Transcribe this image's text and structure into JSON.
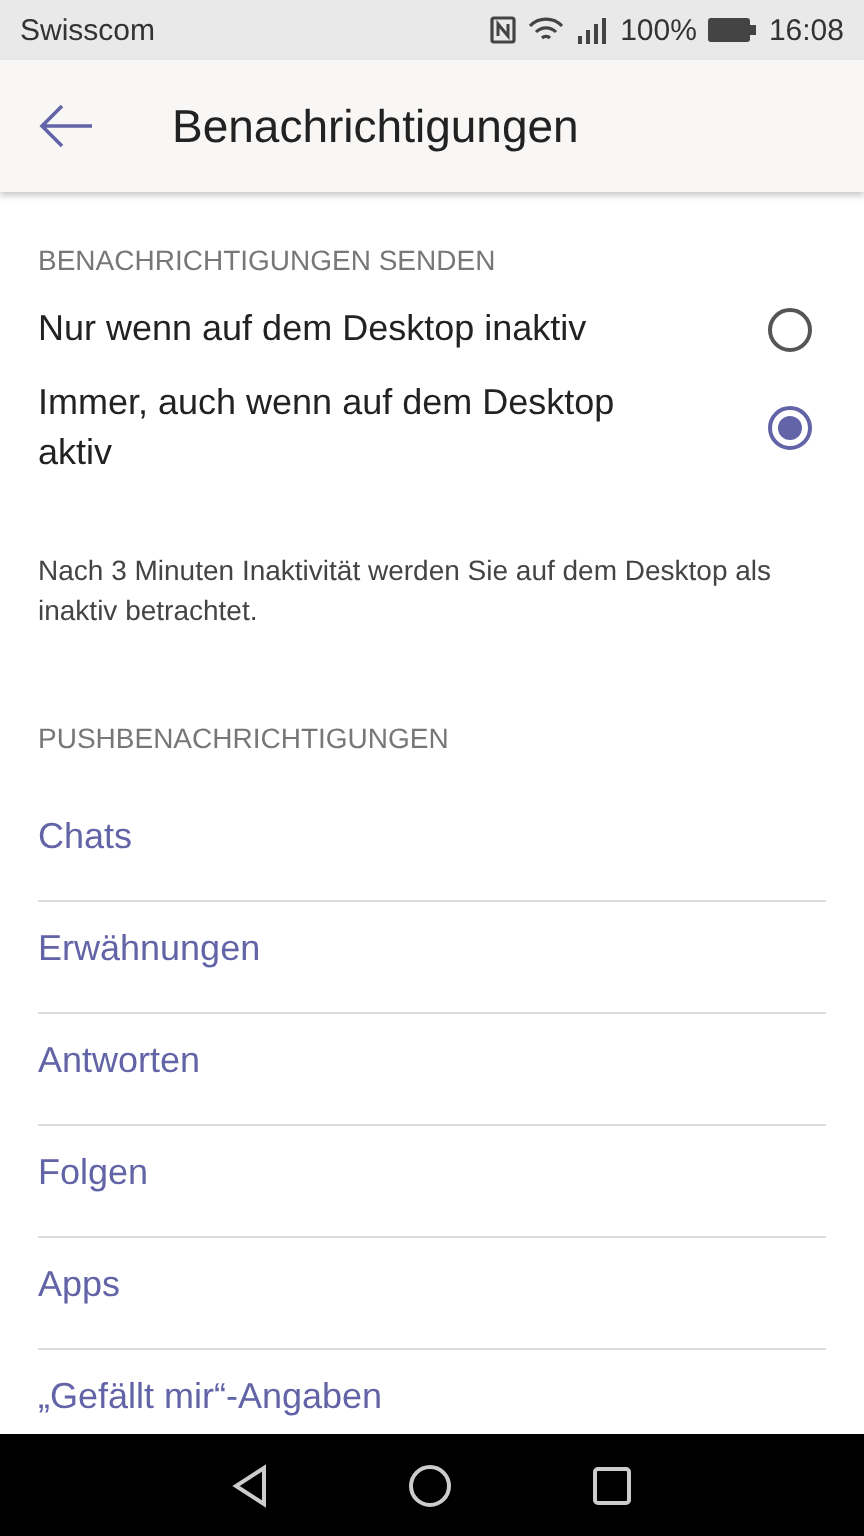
{
  "status_bar": {
    "carrier": "Swisscom",
    "battery": "100%",
    "time": "16:08"
  },
  "app_bar": {
    "title": "Benachrichtigungen"
  },
  "sections": [
    {
      "title": "BENACHRICHTIGUNGEN SENDEN",
      "kind": "radio",
      "options": [
        {
          "label": "Nur wenn auf dem Desktop inaktiv",
          "selected": false
        },
        {
          "label": "Immer, auch wenn auf dem Desktop aktiv",
          "selected": true
        }
      ],
      "note": "Nach 3 Minuten Inaktivität werden Sie auf dem Desktop als inaktiv betrachtet."
    },
    {
      "title": "PUSHBENACHRICHTIGUNGEN",
      "kind": "links",
      "items": [
        "Chats",
        "Erwähnungen",
        "Antworten",
        "Folgen",
        "Apps",
        "„Gefällt mir“-Angaben"
      ]
    }
  ]
}
